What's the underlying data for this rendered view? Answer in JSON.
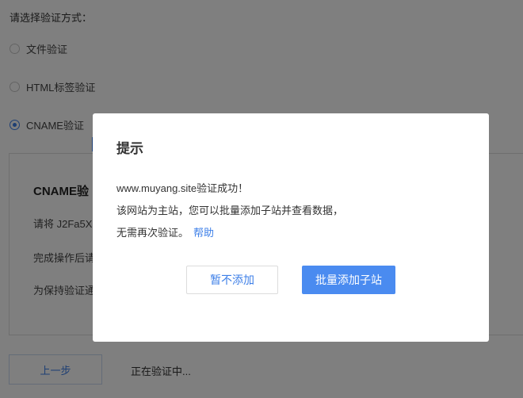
{
  "verify": {
    "prompt": "请选择验证方式：",
    "options": [
      {
        "label": "文件验证",
        "checked": false
      },
      {
        "label": "HTML标签验证",
        "checked": false
      },
      {
        "label": "CNAME验证",
        "checked": true
      }
    ]
  },
  "panel": {
    "title": "CNAME验",
    "line1": "请将 J2Fa5X",
    "line2": "完成操作后请",
    "line3": "为保持验证通"
  },
  "footer": {
    "prev_label": "上一步",
    "status": "正在验证中..."
  },
  "dialog": {
    "title": "提示",
    "line1": "www.muyang.site验证成功！",
    "line2": "该网站为主站，您可以批量添加子站并查看数据，",
    "line3": "无需再次验证。",
    "help_link": "帮助",
    "skip_label": "暂不添加",
    "bulk_label": "批量添加子站"
  },
  "colors": {
    "accent": "#3d7fe8",
    "primary_button": "#4a8bf0",
    "overlay": "rgba(0,0,0,0.5)"
  }
}
